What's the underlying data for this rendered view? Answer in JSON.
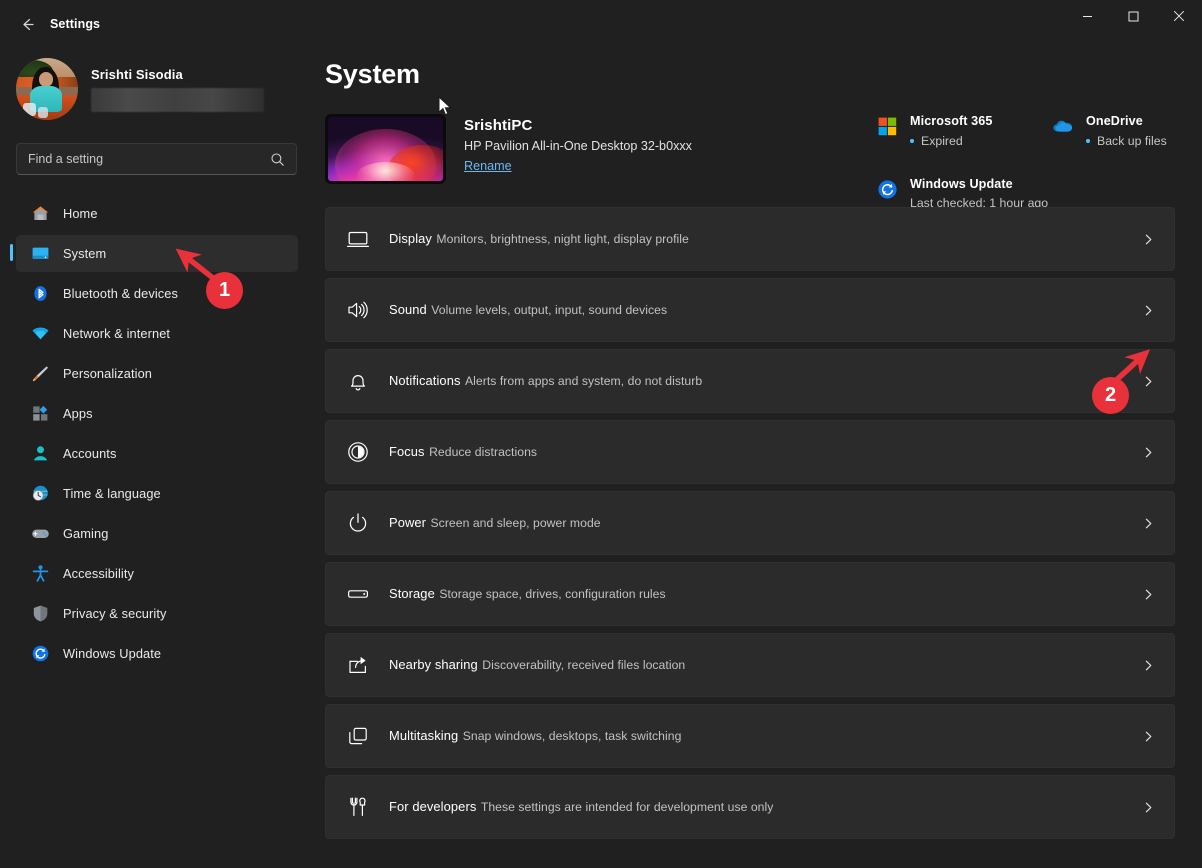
{
  "window": {
    "title": "Settings",
    "back_icon": "back-arrow-icon",
    "minimize_label": "—",
    "maximize_label": "□",
    "close_label": "✕"
  },
  "account": {
    "name": "Srishti Sisodia",
    "email_masked": ""
  },
  "search": {
    "placeholder": "Find a setting",
    "value": "",
    "icon": "search-icon"
  },
  "sidebar": {
    "items": [
      {
        "label": "Home",
        "icon": "home-icon",
        "selected": false
      },
      {
        "label": "System",
        "icon": "system-monitor-icon",
        "selected": true
      },
      {
        "label": "Bluetooth & devices",
        "icon": "bluetooth-icon",
        "selected": false
      },
      {
        "label": "Network & internet",
        "icon": "wifi-icon",
        "selected": false
      },
      {
        "label": "Personalization",
        "icon": "paintbrush-icon",
        "selected": false
      },
      {
        "label": "Apps",
        "icon": "apps-icon",
        "selected": false
      },
      {
        "label": "Accounts",
        "icon": "person-icon",
        "selected": false
      },
      {
        "label": "Time & language",
        "icon": "clock-globe-icon",
        "selected": false
      },
      {
        "label": "Gaming",
        "icon": "gamepad-icon",
        "selected": false
      },
      {
        "label": "Accessibility",
        "icon": "accessibility-icon",
        "selected": false
      },
      {
        "label": "Privacy & security",
        "icon": "shield-icon",
        "selected": false
      },
      {
        "label": "Windows Update",
        "icon": "windows-update-icon",
        "selected": false
      }
    ]
  },
  "main": {
    "page_title": "System",
    "device": {
      "name": "SrishtiPC",
      "model": "HP Pavilion All-in-One Desktop 32-b0xxx",
      "rename_label": "Rename",
      "thumbnail_icon": "windows-bloom-wallpaper"
    },
    "status": [
      {
        "title": "Microsoft 365",
        "sub": "Expired",
        "icon": "microsoft-365-icon"
      },
      {
        "title": "OneDrive",
        "sub": "Back up files",
        "icon": "onedrive-cloud-icon"
      },
      {
        "title": "Windows Update",
        "sub": "Last checked: 1 hour ago",
        "icon": "windows-update-icon"
      }
    ],
    "cards": [
      {
        "title": "Display",
        "sub": "Monitors, brightness, night light, display profile",
        "icon": "monitor-icon"
      },
      {
        "title": "Sound",
        "sub": "Volume levels, output, input, sound devices",
        "icon": "speaker-icon"
      },
      {
        "title": "Notifications",
        "sub": "Alerts from apps and system, do not disturb",
        "icon": "bell-icon"
      },
      {
        "title": "Focus",
        "sub": "Reduce distractions",
        "icon": "focus-icon"
      },
      {
        "title": "Power",
        "sub": "Screen and sleep, power mode",
        "icon": "power-icon"
      },
      {
        "title": "Storage",
        "sub": "Storage space, drives, configuration rules",
        "icon": "storage-drive-icon"
      },
      {
        "title": "Nearby sharing",
        "sub": "Discoverability, received files location",
        "icon": "share-icon"
      },
      {
        "title": "Multitasking",
        "sub": "Snap windows, desktops, task switching",
        "icon": "windows-stack-icon"
      },
      {
        "title": "For developers",
        "sub": "These settings are intended for development use only",
        "icon": "tools-icon"
      }
    ]
  },
  "annotations": [
    {
      "number": "1",
      "target": "sidebar-item-system"
    },
    {
      "number": "2",
      "target": "card-chevron-sound"
    }
  ],
  "colors": {
    "accent": "#4cc2ff",
    "annotation_red": "#e8313a",
    "page_bg": "#202020",
    "card_bg": "#2b2b2b",
    "link": "#6bb8f0"
  }
}
